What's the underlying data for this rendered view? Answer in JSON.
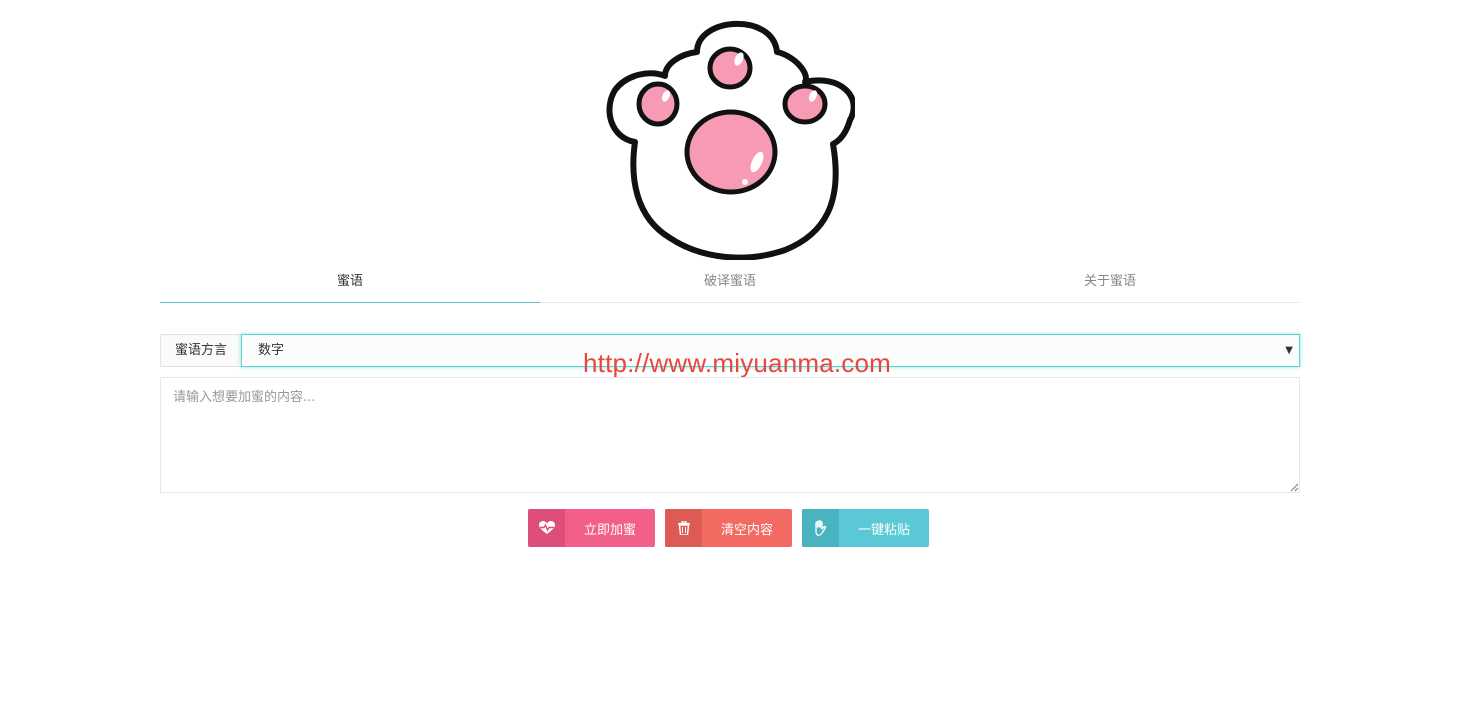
{
  "tabs": [
    {
      "label": "蜜语",
      "active": true
    },
    {
      "label": "破译蜜语",
      "active": false
    },
    {
      "label": "关于蜜语",
      "active": false
    }
  ],
  "dialect": {
    "label": "蜜语方言",
    "selected": "数字"
  },
  "watermark": "http://www.miyuanma.com",
  "content": {
    "placeholder": "请输入想要加蜜的内容...",
    "value": ""
  },
  "buttons": {
    "encrypt": {
      "label": "立即加蜜",
      "icon": "heartbeat-icon",
      "color": "#f2608a"
    },
    "clear": {
      "label": "清空内容",
      "icon": "trash-icon",
      "color": "#f36a62"
    },
    "paste": {
      "label": "一键粘贴",
      "icon": "hand-icon",
      "color": "#5bc8d6"
    }
  },
  "colors": {
    "accent": "#5bc0c9",
    "paw_pad": "#f79ab3"
  }
}
